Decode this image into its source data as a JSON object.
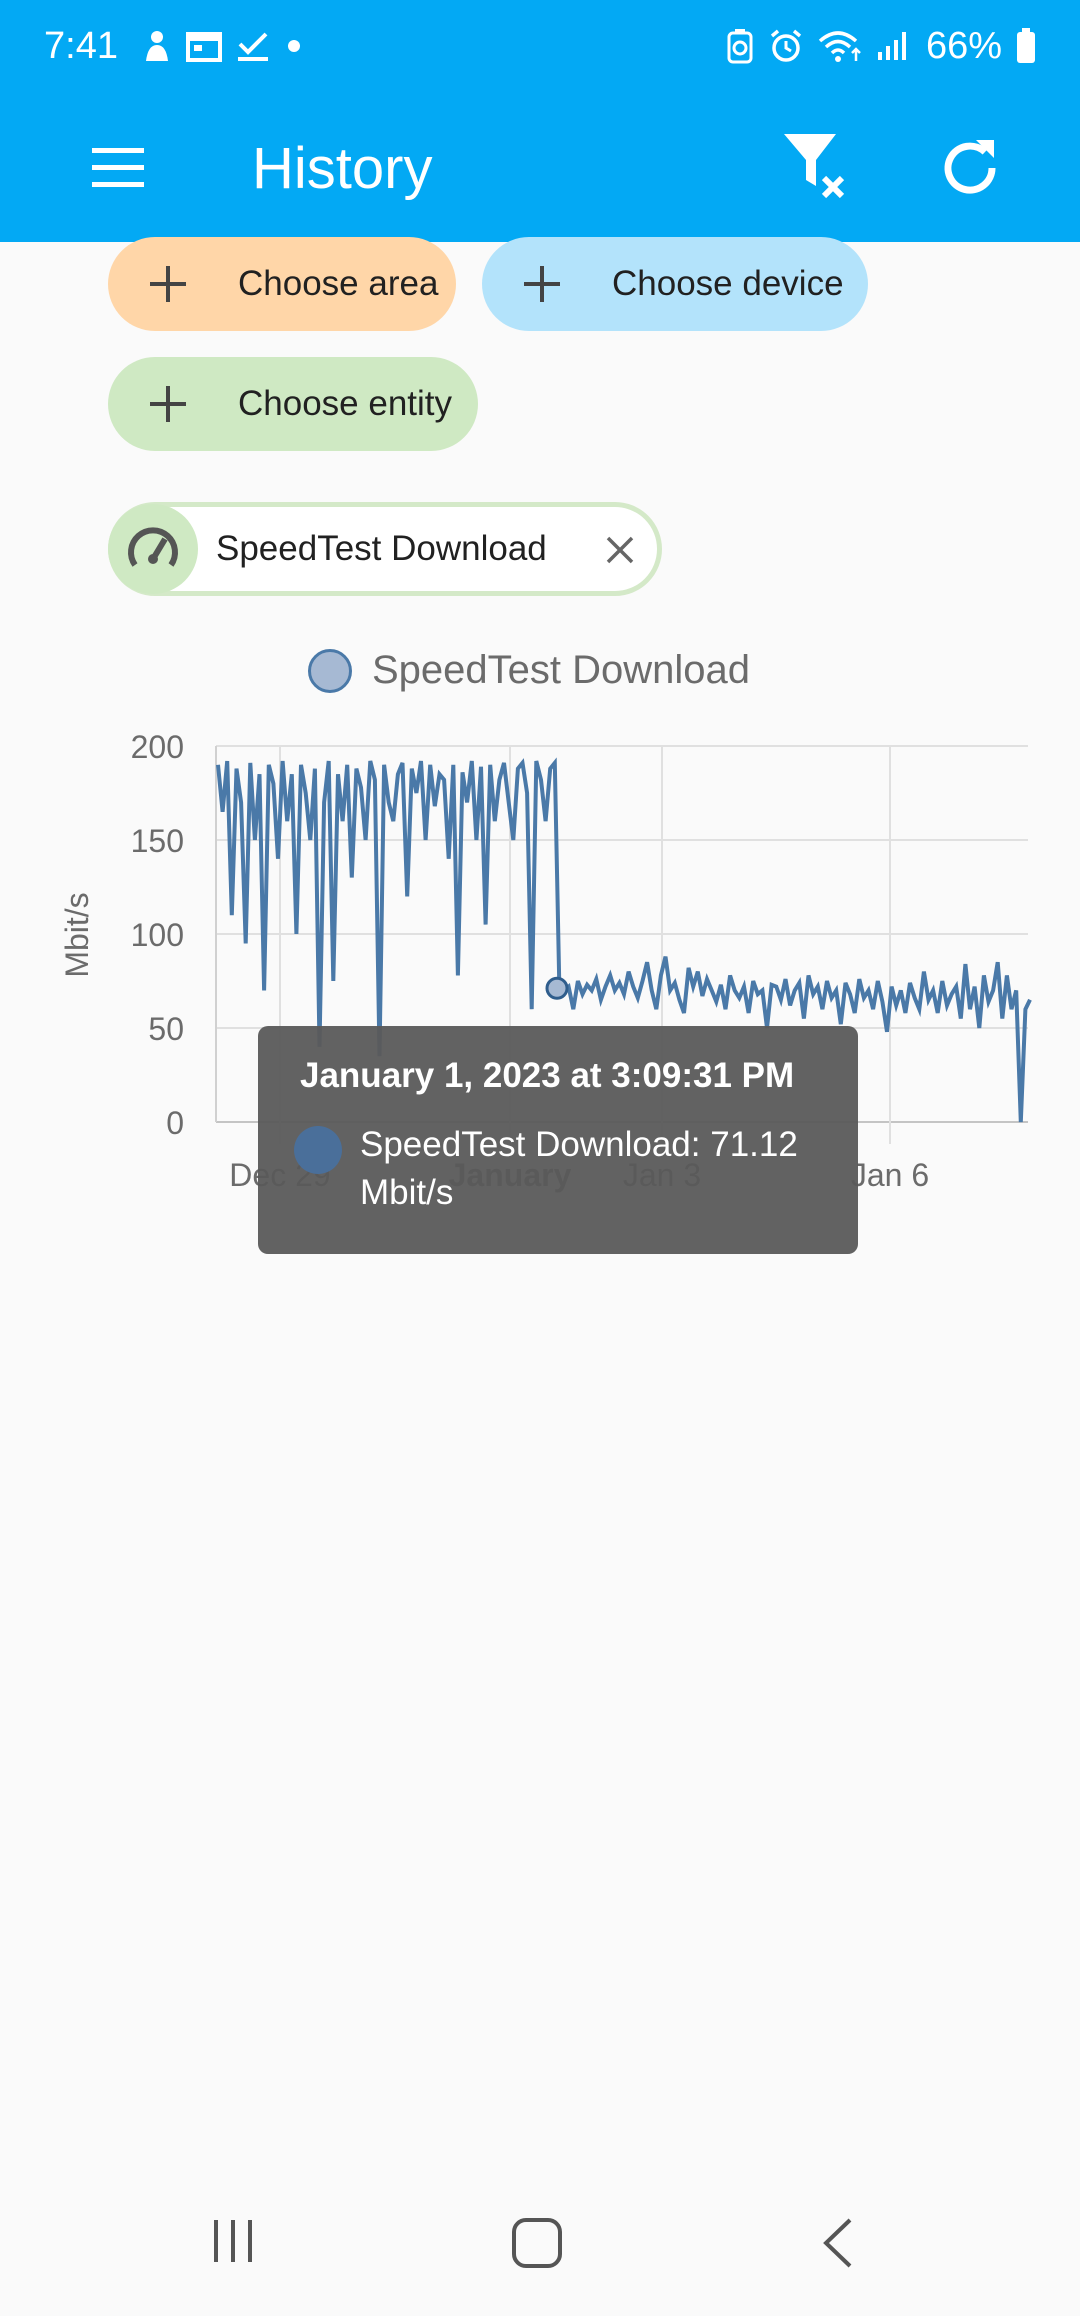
{
  "status_bar": {
    "time": "7:41",
    "battery": "66%",
    "left_icons": [
      "person-icon",
      "calendar-icon",
      "checkbox-icon",
      "dot-icon"
    ],
    "right_icons": [
      "recycle-icon",
      "alarm-icon",
      "wifi-icon",
      "signal-icon",
      "battery-icon"
    ]
  },
  "app_bar": {
    "title": "History",
    "actions": [
      "filter-clear-icon",
      "refresh-icon"
    ],
    "color": "#03a9f4"
  },
  "filters": {
    "area": "Choose area",
    "device": "Choose device",
    "entity": "Choose entity",
    "selected_entity": "SpeedTest Download",
    "colors": {
      "area": "#ffd6a8",
      "device": "#b3e3fb",
      "entity": "#cfe9c3"
    }
  },
  "chart_data": {
    "type": "line",
    "legend": "SpeedTest Download",
    "ylabel": "Mbit/s",
    "ylim": [
      0,
      200
    ],
    "yticks": [
      "200",
      "150",
      "100",
      "50",
      "0"
    ],
    "xticks": [
      "Dec 29",
      "January",
      "Jan 3",
      "Jan 6"
    ],
    "series_color": "#4a79a8",
    "series": [
      {
        "name": "SpeedTest Download",
        "values": [
          190,
          165,
          192,
          110,
          188,
          170,
          95,
          191,
          150,
          185,
          70,
          190,
          180,
          140,
          192,
          160,
          185,
          100,
          190,
          175,
          150,
          188,
          40,
          170,
          192,
          75,
          185,
          160,
          190,
          130,
          188,
          178,
          150,
          192,
          182,
          35,
          190,
          170,
          160,
          185,
          191,
          120,
          188,
          175,
          192,
          150,
          190,
          168,
          185,
          182,
          140,
          190,
          78,
          186,
          170,
          192,
          150,
          189,
          105,
          190,
          160,
          182,
          191,
          170,
          150,
          188,
          191,
          175,
          60,
          192,
          182,
          160,
          188,
          191,
          70,
          70,
          72,
          60,
          75,
          68,
          73,
          70,
          76,
          65,
          72,
          78,
          70,
          74,
          68,
          80,
          72,
          66,
          75,
          85,
          70,
          60,
          78,
          88,
          70,
          74,
          65,
          58,
          82,
          72,
          80,
          67,
          76,
          70,
          64,
          73,
          60,
          78,
          70,
          66,
          72,
          58,
          75,
          68,
          70,
          50,
          73,
          72,
          65,
          76,
          62,
          70,
          74,
          55,
          78,
          68,
          72,
          60,
          75,
          66,
          70,
          52,
          74,
          68,
          58,
          76,
          66,
          70,
          60,
          75,
          64,
          48,
          72,
          62,
          70,
          58,
          74,
          66,
          60,
          80,
          65,
          70,
          58,
          75,
          62,
          68,
          72,
          55,
          84,
          60,
          72,
          50,
          78,
          64,
          70,
          85,
          55,
          78,
          60,
          70,
          0,
          60,
          65
        ]
      }
    ],
    "tooltip": {
      "title": "January 1, 2023 at 3:09:31 PM",
      "text": "SpeedTest Download: 71.12 Mbit/s",
      "value": 71.12
    }
  },
  "nav_bar": {
    "buttons": [
      "recent-apps-icon",
      "home-icon",
      "back-icon"
    ]
  }
}
